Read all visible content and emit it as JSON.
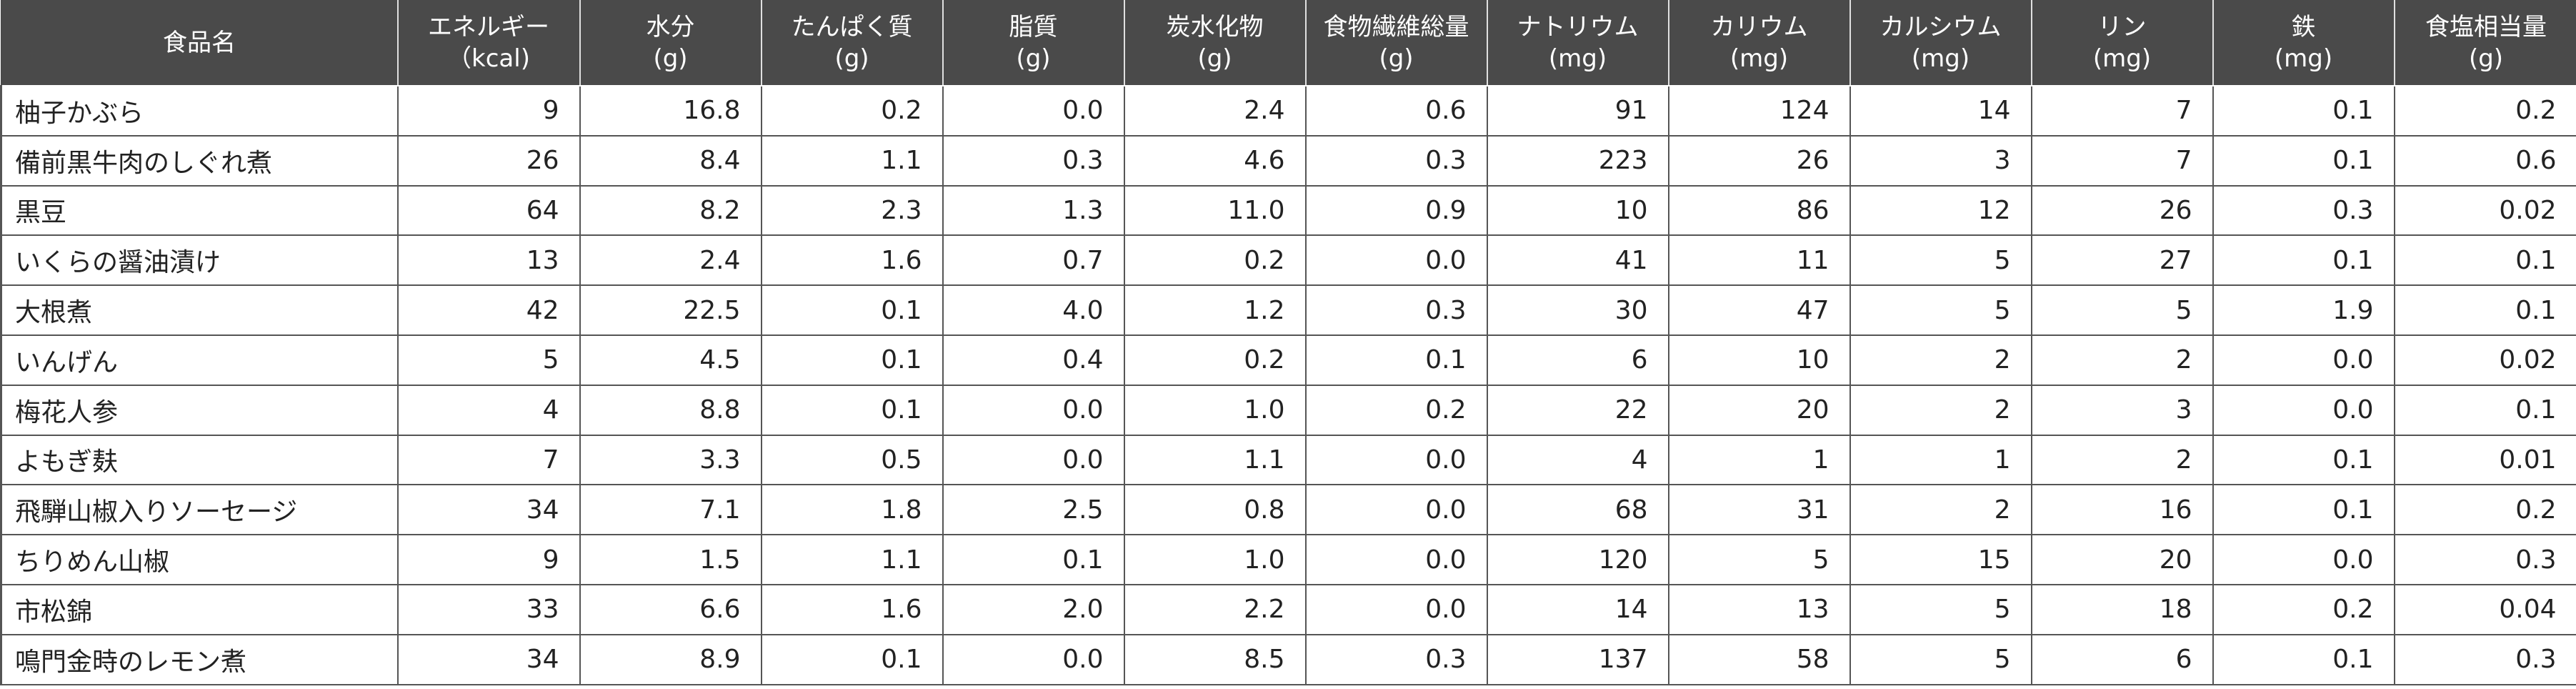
{
  "table": {
    "headers": [
      {
        "line1": "食品名",
        "line2": ""
      },
      {
        "line1": "エネルギー",
        "line2": "（kcal)"
      },
      {
        "line1": "水分",
        "line2": "(g)"
      },
      {
        "line1": "たんぱく質",
        "line2": "(g)"
      },
      {
        "line1": "脂質",
        "line2": "(g)"
      },
      {
        "line1": "炭水化物",
        "line2": "(g)"
      },
      {
        "line1": "食物繊維総量",
        "line2": "(g)"
      },
      {
        "line1": "ナトリウム",
        "line2": "(mg)"
      },
      {
        "line1": "カリウム",
        "line2": "(mg)"
      },
      {
        "line1": "カルシウム",
        "line2": "(mg)"
      },
      {
        "line1": "リン",
        "line2": "(mg)"
      },
      {
        "line1": "鉄",
        "line2": "(mg)"
      },
      {
        "line1": "食塩相当量",
        "line2": "(g)"
      }
    ],
    "rows": [
      [
        "柚子かぶら",
        "9",
        "16.8",
        "0.2",
        "0.0",
        "2.4",
        "0.6",
        "91",
        "124",
        "14",
        "7",
        "0.1",
        "0.2"
      ],
      [
        "備前黒牛肉のしぐれ煮",
        "26",
        "8.4",
        "1.1",
        "0.3",
        "4.6",
        "0.3",
        "223",
        "26",
        "3",
        "7",
        "0.1",
        "0.6"
      ],
      [
        "黒豆",
        "64",
        "8.2",
        "2.3",
        "1.3",
        "11.0",
        "0.9",
        "10",
        "86",
        "12",
        "26",
        "0.3",
        "0.02"
      ],
      [
        "いくらの醤油漬け",
        "13",
        "2.4",
        "1.6",
        "0.7",
        "0.2",
        "0.0",
        "41",
        "11",
        "5",
        "27",
        "0.1",
        "0.1"
      ],
      [
        "大根煮",
        "42",
        "22.5",
        "0.1",
        "4.0",
        "1.2",
        "0.3",
        "30",
        "47",
        "5",
        "5",
        "1.9",
        "0.1"
      ],
      [
        "いんげん",
        "5",
        "4.5",
        "0.1",
        "0.4",
        "0.2",
        "0.1",
        "6",
        "10",
        "2",
        "2",
        "0.0",
        "0.02"
      ],
      [
        "梅花人参",
        "4",
        "8.8",
        "0.1",
        "0.0",
        "1.0",
        "0.2",
        "22",
        "20",
        "2",
        "3",
        "0.0",
        "0.1"
      ],
      [
        "よもぎ麸",
        "7",
        "3.3",
        "0.5",
        "0.0",
        "1.1",
        "0.0",
        "4",
        "1",
        "1",
        "2",
        "0.1",
        "0.01"
      ],
      [
        "飛騨山椒入りソーセージ",
        "34",
        "7.1",
        "1.8",
        "2.5",
        "0.8",
        "0.0",
        "68",
        "31",
        "2",
        "16",
        "0.1",
        "0.2"
      ],
      [
        "ちりめん山椒",
        "9",
        "1.5",
        "1.1",
        "0.1",
        "1.0",
        "0.0",
        "120",
        "5",
        "15",
        "20",
        "0.0",
        "0.3"
      ],
      [
        "市松錦",
        "33",
        "6.6",
        "1.6",
        "2.0",
        "2.2",
        "0.0",
        "14",
        "13",
        "5",
        "18",
        "0.2",
        "0.04"
      ],
      [
        "鳴門金時のレモン煮",
        "34",
        "8.9",
        "0.1",
        "0.0",
        "8.5",
        "0.3",
        "137",
        "58",
        "5",
        "6",
        "0.1",
        "0.3"
      ]
    ]
  }
}
